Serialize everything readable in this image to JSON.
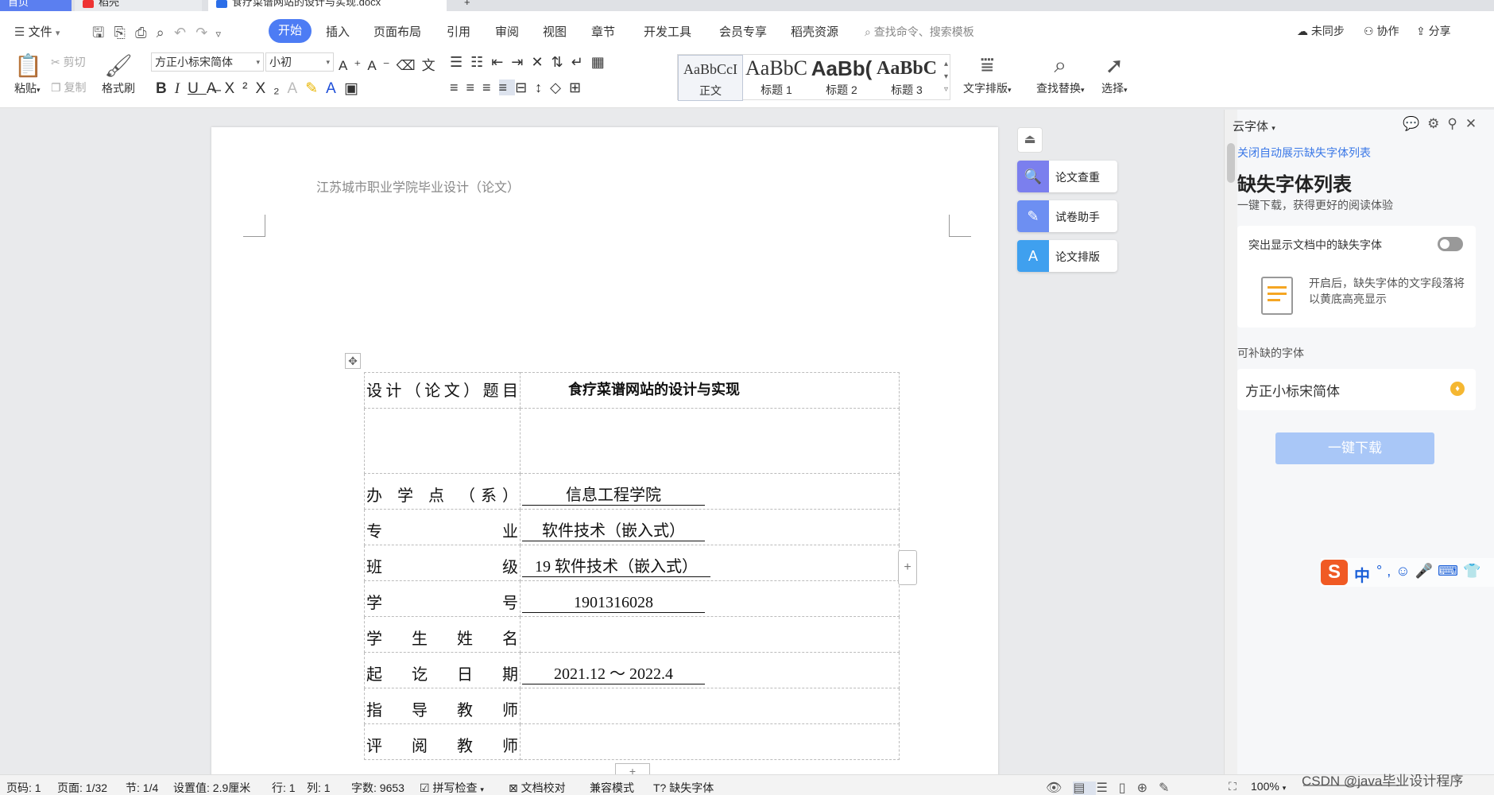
{
  "tabs": {
    "home": "首页",
    "draft": "稻壳",
    "doc": "食疗菜谱网站的设计与实现.docx",
    "new_tab": "+"
  },
  "menubar": {
    "file": "文件",
    "items": [
      "开始",
      "插入",
      "页面布局",
      "引用",
      "审阅",
      "视图",
      "章节",
      "开发工具",
      "会员专享",
      "稻壳资源"
    ],
    "search_placeholder": "查找命令、搜索模板",
    "right": {
      "sync": "未同步",
      "collab": "协作",
      "share": "分享"
    }
  },
  "ribbon": {
    "paste": "粘贴",
    "cut": "剪切",
    "copy": "复制",
    "format_painter": "格式刷",
    "font_name": "方正小标宋简体",
    "font_size": "小初",
    "styles": [
      {
        "sample": "AaBbCcI",
        "label": "正文"
      },
      {
        "sample": "AaBbC",
        "label": "标题 1"
      },
      {
        "sample": "AaBb(",
        "label": "标题 2"
      },
      {
        "sample": "AaBbC",
        "label": "标题 3"
      }
    ],
    "text_layout": "文字排版",
    "find_replace": "查找替换",
    "select": "选择"
  },
  "document": {
    "header": "江苏城市职业学院毕业设计（论文）",
    "rows": [
      {
        "label": "设计（论文）题目",
        "value": "食疗菜谱网站的设计与实现",
        "bold": true,
        "underline": false
      },
      {
        "label": "",
        "value": "",
        "bold": false,
        "underline": false
      },
      {
        "label": "办 学 点 （系）",
        "value": "信息工程学院",
        "bold": false,
        "underline": true
      },
      {
        "label": "专 业",
        "value": "软件技术（嵌入式）",
        "bold": false,
        "underline": true
      },
      {
        "label": "班 级",
        "value": "19 软件技术（嵌入式）",
        "bold": false,
        "underline": true
      },
      {
        "label": "学 号",
        "value": "1901316028",
        "bold": false,
        "underline": true
      },
      {
        "label": "学 生 姓 名",
        "value": "",
        "bold": false,
        "underline": false
      },
      {
        "label": "起 讫 日 期",
        "value": "2021.12 ～ 2022.4",
        "bold": false,
        "underline": true
      },
      {
        "label": "指 导 教 师",
        "value": "",
        "bold": false,
        "underline": false
      },
      {
        "label": "评 阅 教 师",
        "value": "",
        "bold": false,
        "underline": false
      }
    ]
  },
  "side_tools": [
    {
      "label": "论文查重",
      "color": "#7b7fee"
    },
    {
      "label": "试卷助手",
      "color": "#6d8ff2"
    },
    {
      "label": "论文排版",
      "color": "#3fa0ef"
    }
  ],
  "panel": {
    "title": "云字体",
    "close_link": "关闭自动展示缺失字体列表",
    "heading": "缺失字体列表",
    "subheading": "一键下载，获得更好的阅读体验",
    "highlight_label": "突出显示文档中的缺失字体",
    "highlight_desc": "开启后，缺失字体的文字段落将以黄底高亮显示",
    "available_label": "可补缺的字体",
    "font_item": "方正小标宋简体",
    "download_button": "一键下载"
  },
  "statusbar": {
    "page_no": "页码: 1",
    "pages": "页面: 1/32",
    "section": "节: 1/4",
    "setting": "设置值: 2.9厘米",
    "row": "行: 1",
    "col": "列: 1",
    "word_count": "字数: 9653",
    "spell": "拼写检查",
    "proof": "文档校对",
    "compat": "兼容模式",
    "missing_font": "缺失字体",
    "zoom": "100%"
  },
  "watermark": "CSDN @java毕业设计程序"
}
